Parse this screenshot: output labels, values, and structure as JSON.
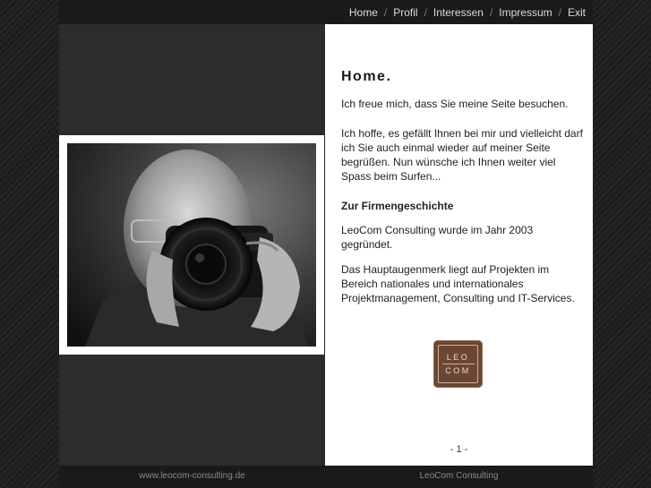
{
  "nav": {
    "items": [
      "Home",
      "Profil",
      "Interessen",
      "Impressum",
      "Exit"
    ],
    "separator": "/"
  },
  "content": {
    "heading": "Home.",
    "p1": "Ich freue mich, dass Sie meine Seite besuchen.",
    "p2": "Ich hoffe, es gefällt Ihnen bei mir und vielleicht darf ich Sie auch einmal wieder auf meiner Seite begrüßen. Nun wünsche ich Ihnen weiter viel Spass beim Surfen...",
    "subheading": "Zur Firmengeschichte",
    "p3": "LeoCom Consulting wurde im Jahr 2003 gegründet.",
    "p4": "Das Hauptaugenmerk liegt auf Projekten im Bereich nationales und internationales Projektmanagement, Consulting und IT-Services."
  },
  "logo": {
    "line1": "LEO",
    "line2": "COM",
    "color": "#6b4733"
  },
  "pager": "- 1 -",
  "footer": {
    "left": "www.leocom-consulting.de",
    "right": "LeoCom Consulting"
  },
  "photo": {
    "description_icon": "portrait-photo-icon"
  }
}
